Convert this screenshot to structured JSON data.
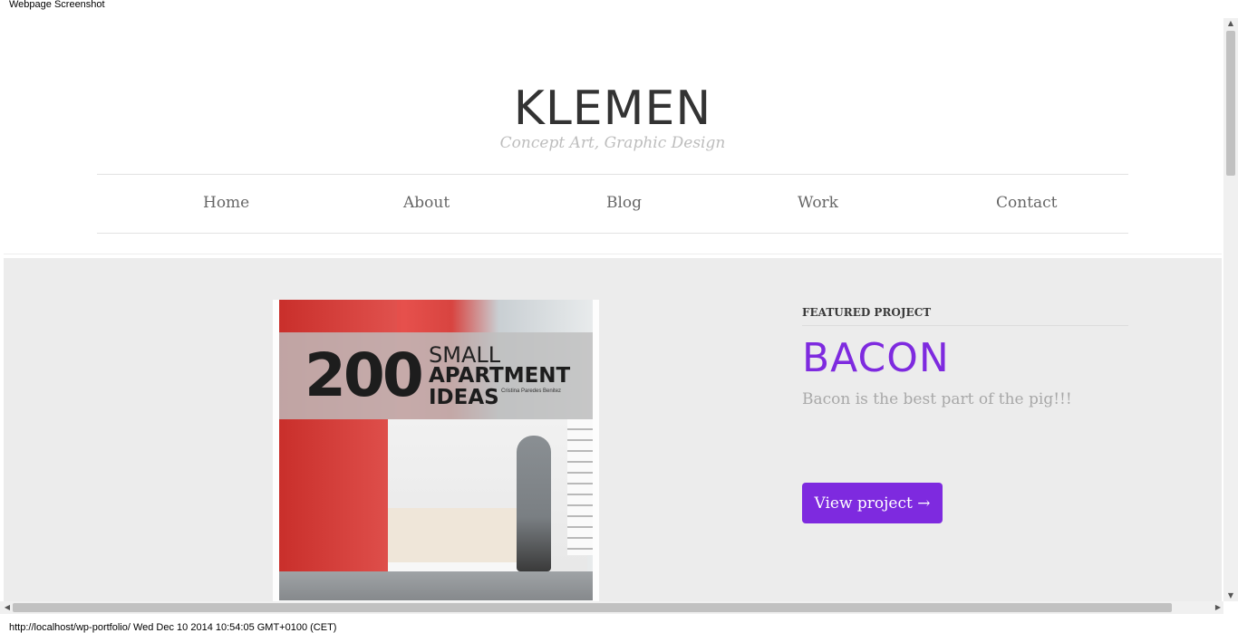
{
  "browser": {
    "caption": "Webpage Screenshot",
    "status": "http://localhost/wp-portfolio/ Wed Dec 10 2014 10:54:05 GMT+0100 (CET)"
  },
  "header": {
    "title": "KLEMEN",
    "tagline": "Concept Art, Graphic Design"
  },
  "nav": {
    "items": [
      {
        "label": "Home"
      },
      {
        "label": "About"
      },
      {
        "label": "Blog"
      },
      {
        "label": "Work"
      },
      {
        "label": "Contact"
      }
    ]
  },
  "featured": {
    "label": "FEATURED PROJECT",
    "title": "BACON",
    "description": "Bacon is the best part of the pig!!!",
    "button_label": "View project →",
    "image": {
      "number": "200",
      "line1": "SMALL",
      "line2": "APARTMENT",
      "line3": "IDEAS",
      "author": "Cristina Paredes Benitez"
    }
  },
  "colors": {
    "accent": "#7e2adf",
    "band": "#ececec"
  },
  "scrollbars": {
    "up": "▲",
    "down": "▼",
    "left": "◀",
    "right": "▶"
  }
}
